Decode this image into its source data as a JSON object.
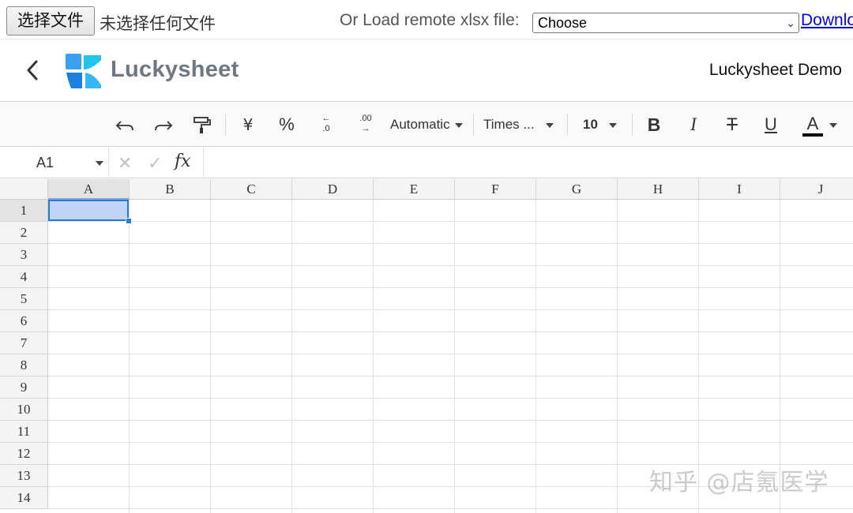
{
  "filebar": {
    "file_button_label": "选择文件",
    "file_status": "未选择任何文件",
    "remote_label": "Or Load remote xlsx file:",
    "remote_select_value": "Choose",
    "download_link": "Download"
  },
  "header": {
    "logo_text": "Luckysheet",
    "demo_title": "Luckysheet Demo"
  },
  "toolbar": {
    "currency_symbol": "¥",
    "percent_symbol": "%",
    "decrease_decimal": ".0",
    "increase_decimal": ".00",
    "format_value": "Automatic",
    "font_family_value": "Times ...",
    "font_size_value": "10",
    "bold_label": "B",
    "italic_label": "I",
    "strike_label": "T",
    "underline_label": "U",
    "text_color_label": "A",
    "text_color": "#000000"
  },
  "formula_bar": {
    "cell_reference": "A1",
    "cancel_symbol": "✕",
    "confirm_symbol": "✓",
    "fx_label": "fx",
    "formula_value": ""
  },
  "grid": {
    "columns": [
      "A",
      "B",
      "C",
      "D",
      "E",
      "F",
      "G",
      "H",
      "I",
      "J"
    ],
    "rows": [
      "1",
      "2",
      "3",
      "4",
      "5",
      "6",
      "7",
      "8",
      "9",
      "10",
      "11",
      "12",
      "13",
      "14"
    ],
    "selected_cell": "A1",
    "selection_color": "#2a7ad8"
  },
  "watermark": "知乎 @店氪医学"
}
